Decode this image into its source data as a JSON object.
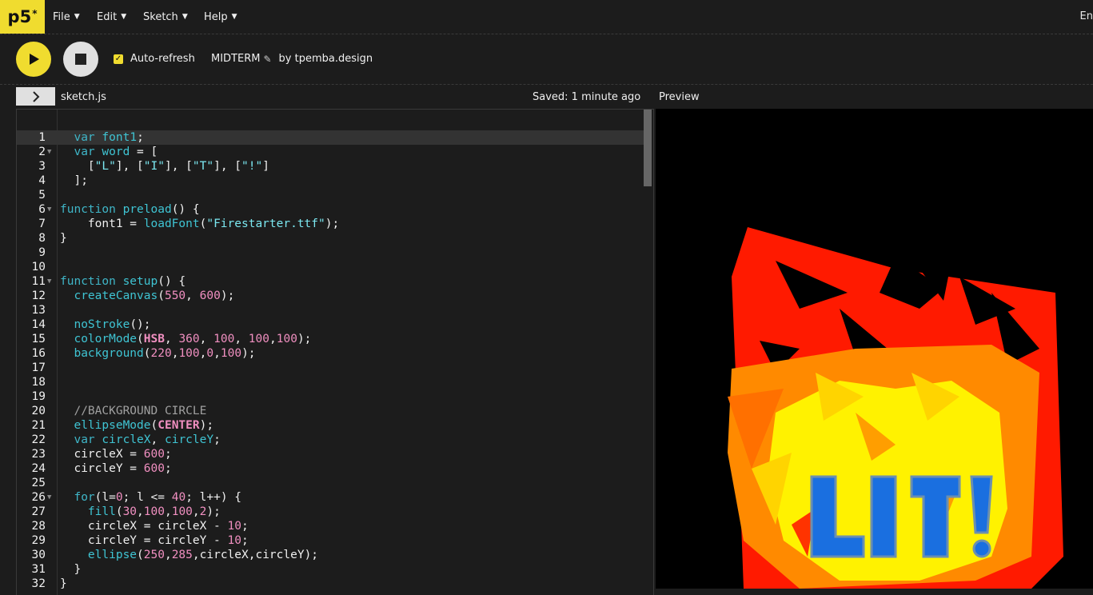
{
  "nav": {
    "logo": "p5",
    "logo_sup": "*",
    "menus": [
      "File",
      "Edit",
      "Sketch",
      "Help"
    ],
    "language": "En"
  },
  "toolbar": {
    "autorefresh_label": "Auto-refresh",
    "autorefresh_checked": true,
    "project_name": "MIDTERM",
    "author": "by tpemba.design"
  },
  "filebar": {
    "filename": "sketch.js",
    "saved_status": "Saved: 1 minute ago",
    "preview_label": "Preview"
  },
  "editor": {
    "lines": [
      "  var font1;",
      "  var word = [",
      "    [\"L\"], [\"I\"], [\"T\"], [\"!\"]",
      "  ];",
      "",
      "function preload() {",
      "    font1 = loadFont(\"Firestarter.ttf\");",
      "}",
      "",
      "",
      "function setup() {",
      "  createCanvas(550, 600);",
      "",
      "  noStroke();",
      "  colorMode(HSB, 360, 100, 100,100);",
      "  background(220,100,0,100);",
      "",
      "",
      "",
      "  //BACKGROUND CIRCLE",
      "  ellipseMode(CENTER);",
      "  var circleX, circleY;",
      "  circleX = 600;",
      "  circleY = 600;",
      "",
      "  for(l=0; l <= 40; l++) {",
      "    fill(30,100,100,2);",
      "    circleX = circleX - 10;",
      "    circleY = circleY - 10;",
      "    ellipse(250,285,circleX,circleY);",
      "  }",
      "}"
    ],
    "fold_lines": [
      2,
      6,
      11,
      26
    ],
    "active_line": 1
  },
  "preview": {
    "text": "LIT!",
    "colors": {
      "red": "#ff1a00",
      "orange": "#ff8a00",
      "yellow": "#fff200",
      "blue": "#1a6fe0"
    }
  }
}
